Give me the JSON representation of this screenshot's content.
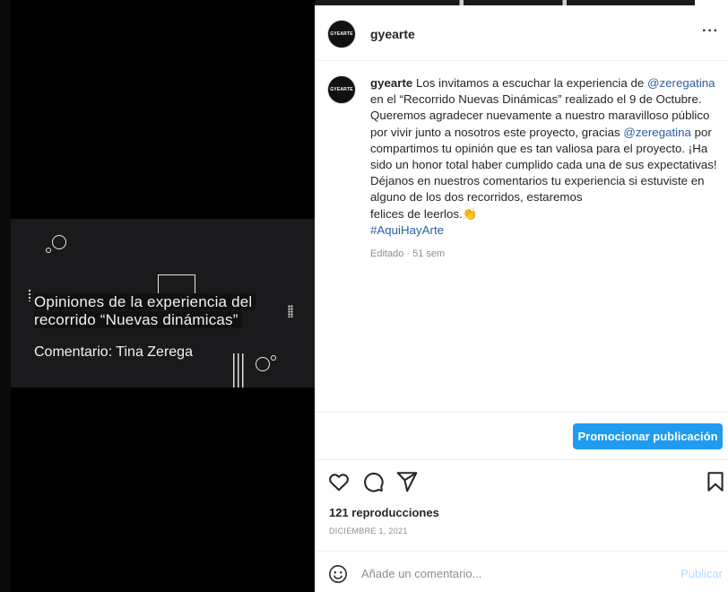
{
  "media": {
    "title_line1": "Opiniones de la experiencia del",
    "title_line2": "recorrido “Nuevas dinámicas”",
    "subtitle": "Comentario: Tina Zerega"
  },
  "header": {
    "avatar_text": "GYEARTE",
    "username": "gyearte",
    "more_label": "···"
  },
  "caption": {
    "username": "gyearte",
    "t1": " Los invitamos a escuchar la experiencia de ",
    "mention1": "@zeregatina",
    "t2": " en el “Recorrido Nuevas Dinámicas” realizado el 9 de Octubre. Queremos agradecer nuevamente a nuestro maravilloso público por vivir junto a nosotros este proyecto, gracias ",
    "mention2": "@zeregatina",
    "t3": " por compartimos tu opinión que es tan valiosa para el proyecto. ¡Ha sido un honor total haber cumplido cada una de sus expectativas!",
    "t4": "Déjanos en nuestros comentarios tu experiencia si estuviste en alguno de los dos recorridos, estaremos",
    "t5": "felices de leerlos.",
    "emoji": "👏",
    "hashtag": "#AquiHayArte",
    "meta": "Editado · 51 sem"
  },
  "promote": {
    "label": "Promocionar publicación"
  },
  "actions": {
    "like_icon": "heart-icon",
    "comment_icon": "comment-icon",
    "share_icon": "paper-plane-icon",
    "save_icon": "bookmark-icon"
  },
  "stats": {
    "views": "121 reproducciones"
  },
  "date": "DICIEMBRE 1, 2021",
  "comment_bar": {
    "placeholder": "Añade un comentario...",
    "publish_label": "Publicar"
  },
  "colors": {
    "accent": "#1f9bf0",
    "link": "#2b5f9e",
    "publish_disabled": "#b3dbff"
  }
}
